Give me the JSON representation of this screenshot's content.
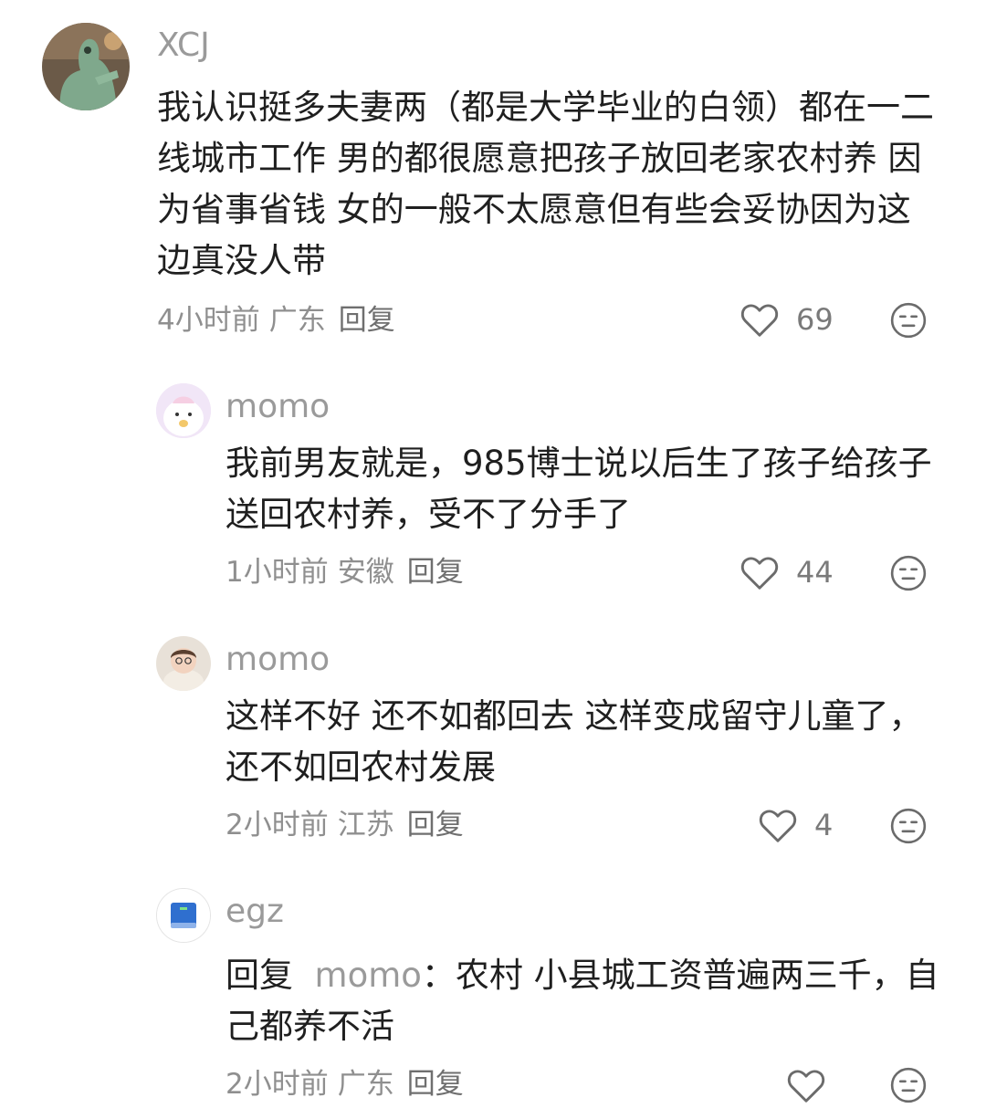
{
  "comments": [
    {
      "username": "XCJ",
      "text": "我认识挺多夫妻两（都是大学毕业的白领）都在一二线城市工作 男的都很愿意把孩子放回老家农村养 因为省事省钱 女的一般不太愿意但有些会妥协因为这边真没人带",
      "time": "4小时前",
      "location": "广东",
      "reply_label": "回复",
      "likes": "69"
    },
    {
      "username": "momo",
      "text": "我前男友就是，985博士说以后生了孩子给孩子送回农村养，受不了分手了",
      "time": "1小时前",
      "location": "安徽",
      "reply_label": "回复",
      "likes": "44"
    },
    {
      "username": "momo",
      "text": "这样不好 还不如都回去 这样变成留守儿童了，还不如回农村发展",
      "time": "2小时前",
      "location": "江苏",
      "reply_label": "回复",
      "likes": "4"
    },
    {
      "username": "egz",
      "reply_prefix": "回复",
      "reply_to": "momo",
      "reply_colon": "：",
      "text": "农村 小县城工资普遍两三千，自己都养不活",
      "time": "2小时前",
      "location": "广东",
      "reply_label": "回复",
      "likes": ""
    }
  ],
  "icons": {
    "like": "heart-outline-icon",
    "dislike": "meh-face-icon"
  },
  "colors": {
    "username": "#9a9a9a",
    "text": "#1f1f1f",
    "meta": "#8f8f8f",
    "icon": "#6b6b6b"
  }
}
